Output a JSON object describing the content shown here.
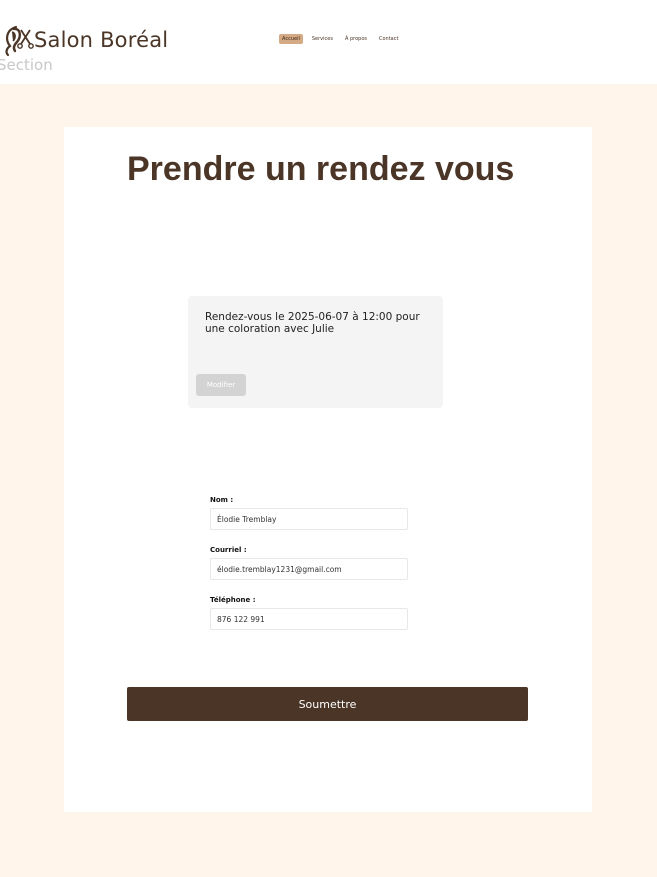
{
  "header": {
    "brand": "Salon Boréal",
    "ghost_text": "Section",
    "nav": [
      {
        "label": "Accueil",
        "active": true
      },
      {
        "label": "Services",
        "active": false
      },
      {
        "label": "À propos",
        "active": false
      },
      {
        "label": "Contact",
        "active": false
      }
    ]
  },
  "main": {
    "title": "Prendre un rendez vous",
    "appointment": {
      "text": "Rendez-vous le 2025-06-07 à 12:00 pour une coloration avec Julie",
      "modify_label": "Modifier"
    },
    "form": {
      "name_label": "Nom :",
      "name_value": "Élodie Tremblay",
      "email_label": "Courriel :",
      "email_value": "élodie.tremblay1231@gmail.com",
      "phone_label": "Téléphone :",
      "phone_value": "876 122 991",
      "submit_label": "Soumettre"
    }
  },
  "colors": {
    "brand_brown": "#4a3526",
    "accent_tan": "#d3aa83",
    "page_background": "#fff5eb",
    "appointment_box": "#f4f4f4"
  },
  "icons": {
    "logo": "hair-salon-logo-icon"
  }
}
